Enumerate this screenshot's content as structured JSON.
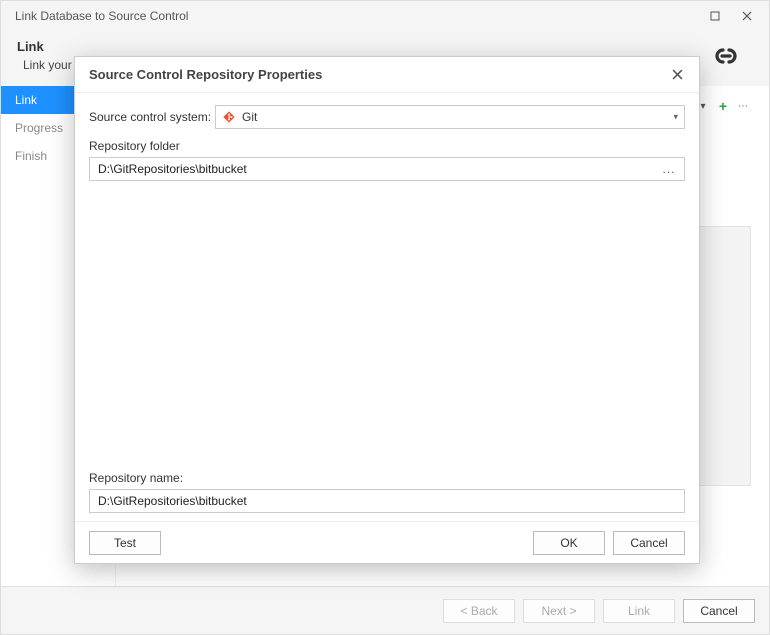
{
  "window": {
    "title": "Link Database to Source Control"
  },
  "header": {
    "title": "Link",
    "subtitle": "Link your"
  },
  "sidebar": {
    "items": [
      {
        "label": "Link",
        "active": true
      },
      {
        "label": "Progress",
        "active": false
      },
      {
        "label": "Finish",
        "active": false
      }
    ]
  },
  "wizard_footer": {
    "back": "< Back",
    "next": "Next >",
    "link": "Link",
    "cancel": "Cancel"
  },
  "modal": {
    "title": "Source Control Repository Properties",
    "source_system_label": "Source control system:",
    "source_system_value": "Git",
    "repo_folder_label": "Repository folder",
    "repo_folder_value": "D:\\GitRepositories\\bitbucket",
    "repo_name_label": "Repository name:",
    "repo_name_value": "D:\\GitRepositories\\bitbucket",
    "buttons": {
      "test": "Test",
      "ok": "OK",
      "cancel": "Cancel"
    }
  }
}
